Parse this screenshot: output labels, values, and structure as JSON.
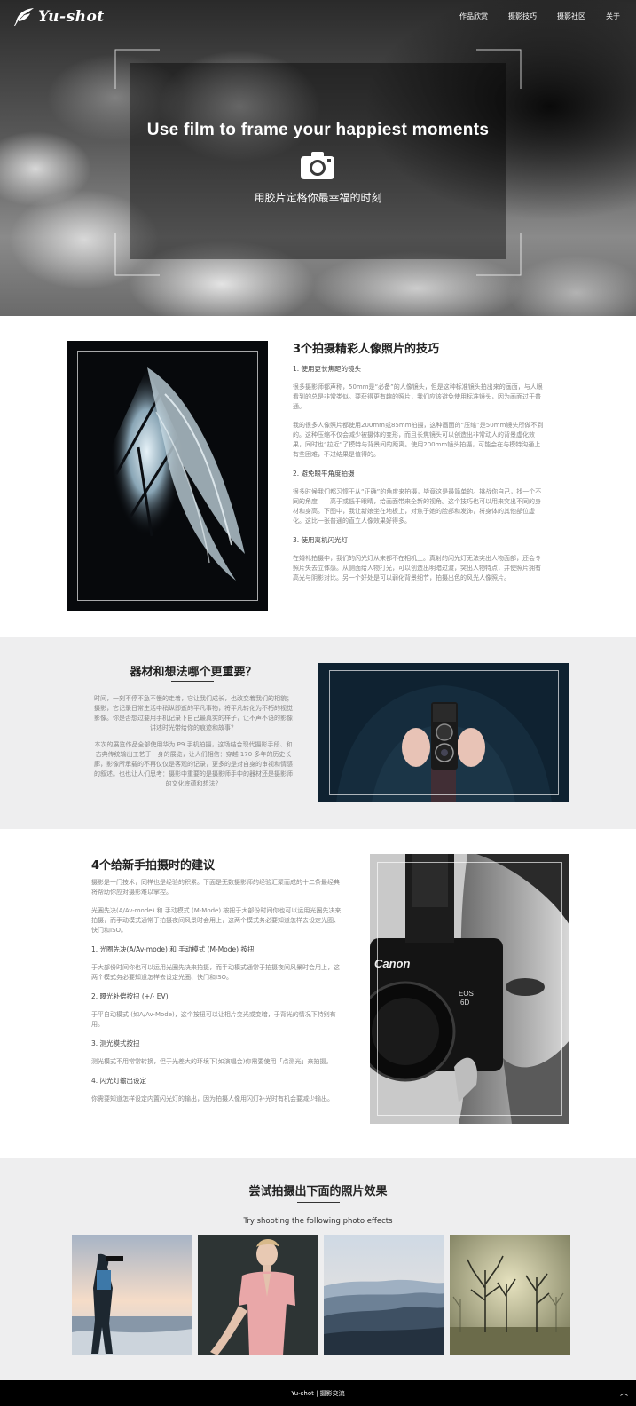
{
  "brand": {
    "name": "Yu-shot"
  },
  "nav": {
    "items": [
      "作品欣赏",
      "摄影技巧",
      "摄影社区",
      "关于"
    ]
  },
  "hero": {
    "title": "Use film to frame your happiest moments",
    "subtitle": "用胶片定格你最幸福的时刻",
    "icon": "camera-icon"
  },
  "section1": {
    "title": "3个拍摄精彩人像照片的技巧",
    "items": [
      {
        "heading": "1. 使用更长焦距的镜头",
        "paragraphs": [
          "很多摄影师都声称，50mm是“必备”的人像镜头，但是这种标准镜头拍出来的画面，与人眼看到的总是非常类似。要获得更有趣的照片，我们应该避免使用标准镜头，因为画面过于普通。",
          "我的很多人像照片都使用200mm或85mm拍摄，这种画面的“压缩”是50mm镜头所做不到的。这种压缩不仅会减少被摄体的变形，而且长焦镜头可以创造出非常动人的背景虚化效果，同时也“拉近”了模特与背景间的距离。使用200mm镜头拍摄，可能会在与模特沟通上有些困难，不过结果是值得的。"
        ]
      },
      {
        "heading": "2. 避免眼平角度拍摄",
        "paragraphs": [
          "很多时候我们都习惯于从“正确”的角度来拍摄，毕竟这是最简单的。挑战你自己，找一个不同的角度——高于或低于眼睛，给画面带来全新的视角。这个技巧也可以用来突出不同的身材和身高。下图中，我让新娘坐在地板上，对焦于她的脸部和发饰，将身体的其他部位虚化。这比一张普通的直立人像效果好得多。"
        ]
      },
      {
        "heading": "3. 使用离机闪光灯",
        "paragraphs": [
          "在婚礼拍摄中，我们的闪光灯从来都不在相机上。真射的闪光灯无法突出人物面部，还会令照片失去立体感。从侧面给人物打光，可以创造出明暗过渡，突出人物特点，并使照片拥有高光与阴影对比。另一个好处是可以弱化背景细节，拍摄出色的风光人像照片。"
        ]
      }
    ]
  },
  "section2": {
    "title": "器材和想法哪个更重要？",
    "paragraphs": [
      "时间，一刻不停不急不慢的走着，它让我们成长，也改变着我们的相貌；摄影，它记录日常生活中稍纵即逝的平凡事物，将平凡转化为不朽的视觉影像。你是否想过要用手机记录下自己最真实的样子，让不声不语的影像讲述时光带给你的痕迹和故事？",
      "本次的展览作品全部使用华为 P9 手机拍摄，这场结合现代摄影手段、和古典传统输出工艺于一身的展览，让人们相信：穿越 170 多年的历史长廊，影像所承载的不再仅仅是客观的记录，更多的是对自身的审视和情感的叙述。也也让人们思考：摄影中重要的是摄影师手中的器材还是摄影师的文化底蕴和想法？"
    ]
  },
  "section3": {
    "title": "4个给新手拍摄时的建议",
    "intro": [
      "摄影是一门技术，同样也是经验的积累。下面是无数摄影师的经验汇聚而成的十二条最经典将帮助你应对摄影难以掌控。",
      "光圈先决(A/Av-mode) 和 手动模式 (M-Mode) 按扭于大部份时间你也可以运用光圈先决来拍摄，而手动模式通常于拍摄夜间风景时会用上，这两个模式务必要知道怎样去设定光圈、快门和ISO。"
    ],
    "items": [
      {
        "heading": "1. 光圈先决(A/Av-mode) 和 手动模式 (M-Mode) 按扭",
        "text": "于大部份时间你也可以运用光圈先决来拍摄，而手动模式通常于拍摄夜间风景时会用上，这两个模式务必要知道怎样去设定光圈、快门和ISO。"
      },
      {
        "heading": "2. 曝光补偿按扭 (+/- EV)",
        "text": "于平自动模式 (如A/Av-Mode)，这个按扭可以让相片变光或变暗，于背光的情况下特别有用。"
      },
      {
        "heading": "3. 测光模式按扭",
        "text": "测光模式不用常常转换，但于光差大的环境下(如演唱会)你需要使用「点测光」来拍摄。"
      },
      {
        "heading": "4. 闪光灯输出设定",
        "text": "你需要知道怎样设定内置闪光灯的输出，因为拍摄人像用闪灯补光时有机会要减少输出。"
      }
    ]
  },
  "section4": {
    "title": "尝试拍摄出下面的照片效果",
    "subtitle": "Try shooting the following photo effects",
    "photos": [
      "photographer-at-sea",
      "woman-in-pink",
      "misty-mountains",
      "foggy-trees"
    ]
  },
  "footer": {
    "text": "Yu-shot | 摄影交流",
    "to_top": "︿"
  },
  "colors": {
    "hero_dark": "#0a0a0a",
    "section_gray": "#eeeeef",
    "footer": "#000000"
  }
}
